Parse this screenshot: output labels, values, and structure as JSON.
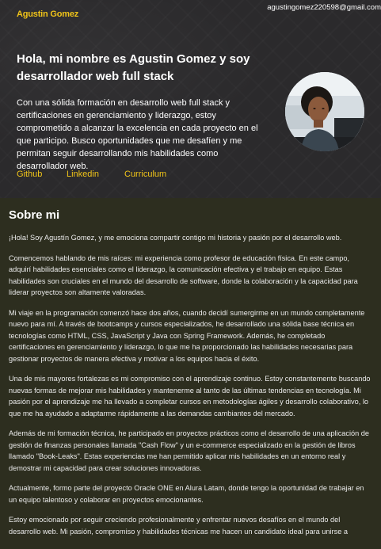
{
  "header": {
    "logo": "Agustin Gomez",
    "email": "agustingomez220598@gmail.com"
  },
  "hero": {
    "headline": "Hola, mi nombre es Agustin Gomez y soy desarrollador web full stack",
    "intro": "Con una sólida formación en desarrollo web full stack y certificaciones en gerenciamiento y liderazgo, estoy comprometido a alcanzar la excelencia en cada proyecto en el que participo. Busco oportunidades que me desafíen y me permitan seguir desarrollando mis habilidades como desarrollador web.",
    "links": [
      {
        "label": "Github"
      },
      {
        "label": "Linkedin"
      },
      {
        "label": "Curriculum"
      }
    ]
  },
  "about": {
    "title": "Sobre mi",
    "paragraphs": [
      "¡Hola! Soy Agustín Gomez, y me emociona compartir contigo mi historia y pasión por el desarrollo web.",
      "Comencemos hablando de mis raíces: mi experiencia como profesor de educación física. En este campo, adquirí habilidades esenciales como el liderazgo, la comunicación efectiva y el trabajo en equipo. Estas habilidades son cruciales en el mundo del desarrollo de software, donde la colaboración y la capacidad para liderar proyectos son altamente valoradas.",
      "Mi viaje en la programación comenzó hace dos años, cuando decidí sumergirme en un mundo completamente nuevo para mí. A través de bootcamps y cursos especializados, he desarrollado una sólida base técnica en tecnologías como HTML, CSS, JavaScript y Java con Spring Framework. Además, he completado certificaciones en gerenciamiento y liderazgo, lo que me ha proporcionado las habilidades necesarias para gestionar proyectos de manera efectiva y motivar a los equipos hacia el éxito.",
      "Una de mis mayores fortalezas es mi compromiso con el aprendizaje continuo. Estoy constantemente buscando nuevas formas de mejorar mis habilidades y mantenerme al tanto de las últimas tendencias en tecnología. Mi pasión por el aprendizaje me ha llevado a completar cursos en metodologías ágiles y desarrollo colaborativo, lo que me ha ayudado a adaptarme rápidamente a las demandas cambiantes del mercado.",
      "Además de mi formación técnica, he participado en proyectos prácticos como el desarrollo de una aplicación de gestión de finanzas personales llamada \"Cash Flow\" y un e-commerce especializado en la gestión de libros llamado \"Book-Leaks\". Estas experiencias me han permitido aplicar mis habilidades en un entorno real y demostrar mi capacidad para crear soluciones innovadoras.",
      "Actualmente, formo parte del proyecto Oracle ONE en Alura Latam, donde tengo la oportunidad de trabajar en un equipo talentoso y colaborar en proyectos emocionantes.",
      "Estoy emocionado por seguir creciendo profesionalmente y enfrentar nuevos desafíos en el mundo del desarrollo web. Mi pasión, compromiso y habilidades técnicas me hacen un candidato ideal para unirse a"
    ]
  }
}
